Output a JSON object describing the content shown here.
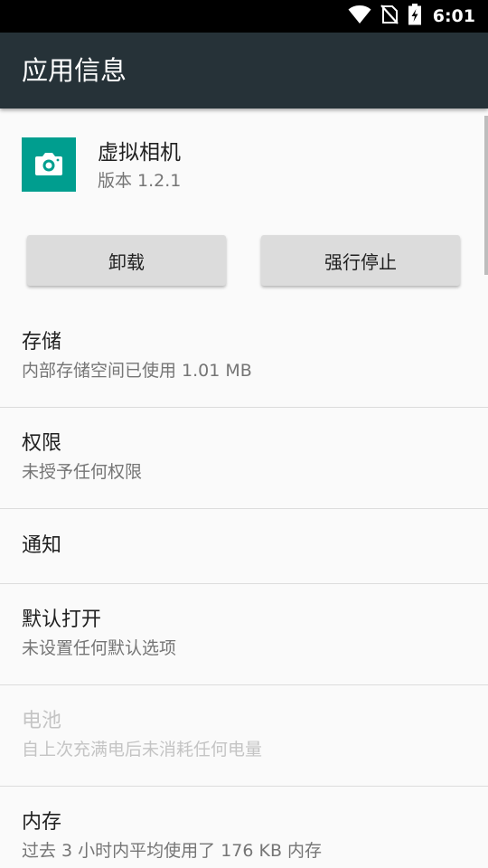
{
  "status_bar": {
    "time": "6:01",
    "icons": [
      "wifi-icon",
      "no-sim-icon",
      "battery-charging-icon"
    ]
  },
  "app_bar": {
    "title": "应用信息"
  },
  "app": {
    "name": "虚拟相机",
    "version": "版本 1.2.1",
    "icon": "camera-icon",
    "icon_color": "#009e8f"
  },
  "buttons": {
    "uninstall": "卸载",
    "force_stop": "强行停止"
  },
  "items": [
    {
      "title": "存储",
      "summary": "内部存储空间已使用 1.01 MB",
      "enabled": true
    },
    {
      "title": "权限",
      "summary": "未授予任何权限",
      "enabled": true
    },
    {
      "title": "通知",
      "summary": "",
      "enabled": true
    },
    {
      "title": "默认打开",
      "summary": "未设置任何默认选项",
      "enabled": true
    },
    {
      "title": "电池",
      "summary": "自上次充满电后未消耗任何电量",
      "enabled": false
    },
    {
      "title": "内存",
      "summary": "过去 3 小时内平均使用了 176 KB 内存",
      "enabled": true
    }
  ],
  "colors": {
    "app_bar": "#263238",
    "status_bar": "#000000",
    "background": "#fafafa",
    "button": "#dcdcdc"
  }
}
